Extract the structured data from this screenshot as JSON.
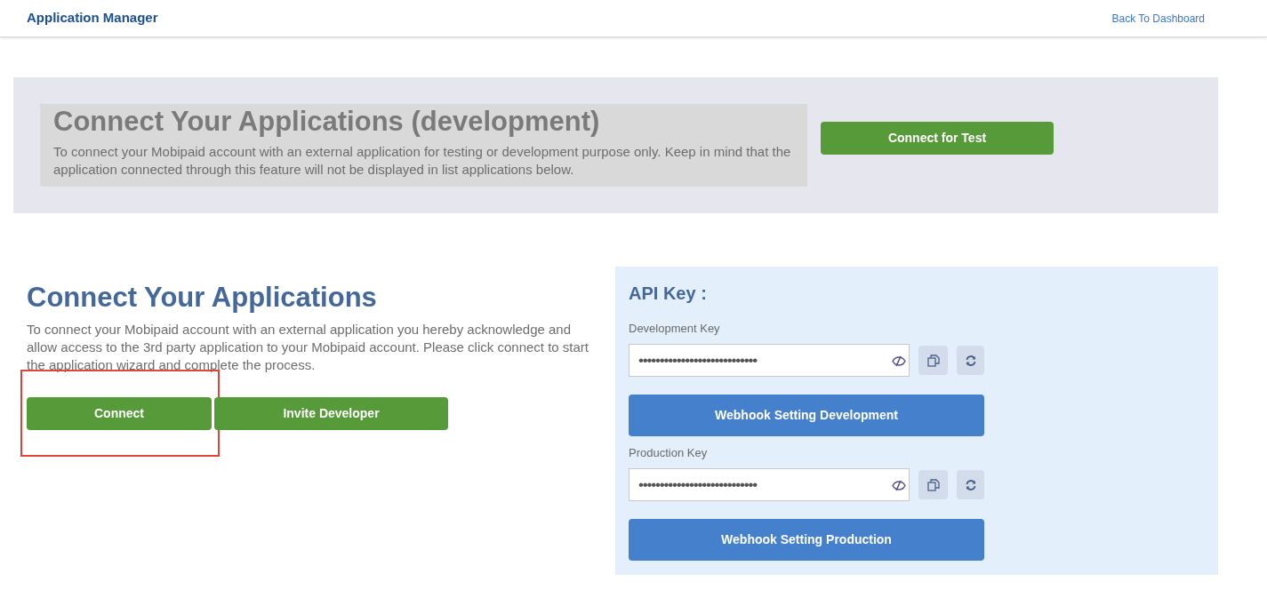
{
  "header": {
    "title": "Application Manager",
    "back_link": "Back To Dashboard"
  },
  "dev_section": {
    "title": "Connect Your Applications (development)",
    "description": "To connect your Mobipaid account with an external application for testing or development purpose only. Keep in mind that the application connected through this feature will not be displayed in list applications below.",
    "button": "Connect for Test"
  },
  "connect_section": {
    "title": "Connect Your Applications",
    "description": "To connect your Mobipaid account with an external application you hereby acknowledge and allow access to the 3rd party application to your Mobipaid account. Please click connect to start the application wizard and complete the process.",
    "buttons": [
      {
        "label": "Connect",
        "highlighted": true
      },
      {
        "label": "Invite Developer",
        "highlighted": false
      }
    ]
  },
  "api_key": {
    "title": "API Key :",
    "keys": [
      {
        "label": "Development Key",
        "value": "••••••••••••••••••••••••••••",
        "webhook_button": "Webhook Setting Development"
      },
      {
        "label": "Production Key",
        "value": "••••••••••••••••••••••••••••",
        "webhook_button": "Webhook Setting Production"
      }
    ]
  }
}
